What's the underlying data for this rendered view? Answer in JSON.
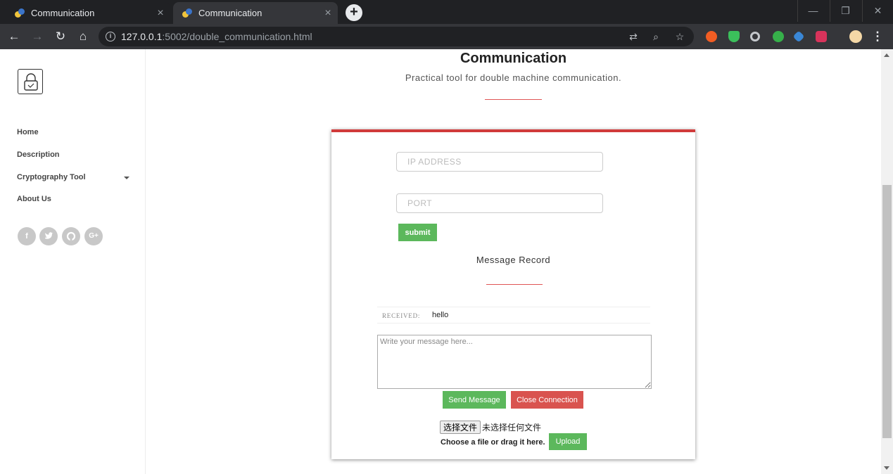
{
  "browser": {
    "tabs": [
      {
        "title": "Communication",
        "active": false
      },
      {
        "title": "Communication",
        "active": true
      }
    ],
    "url_host": "127.0.0.1",
    "url_rest": ":5002/double_communication.html"
  },
  "sidebar": {
    "nav": [
      {
        "label": "Home"
      },
      {
        "label": "Description"
      },
      {
        "label": "Cryptography Tool"
      },
      {
        "label": "About Us"
      }
    ],
    "social": [
      "f",
      "t",
      "gh",
      "G+"
    ]
  },
  "header": {
    "title": "Communication",
    "subtitle": "Practical tool for double machine communication."
  },
  "form": {
    "ip_placeholder": "IP ADDRESS",
    "port_placeholder": "PORT",
    "submit_label": "submit"
  },
  "record": {
    "title": "Message Record",
    "messages": [
      {
        "label": "RECEIVED:",
        "text": "hello"
      }
    ],
    "input_placeholder": "Write your message here...",
    "send_label": "Send Message",
    "close_label": "Close Connection"
  },
  "upload": {
    "choose_label": "选择文件",
    "no_file_text": "未选择任何文件",
    "hint": "Choose a file or drag it here.",
    "upload_label": "Upload"
  },
  "colors": {
    "accent_red": "#d13b3b",
    "success_green": "#5cb85c",
    "danger_red": "#d9534f"
  }
}
